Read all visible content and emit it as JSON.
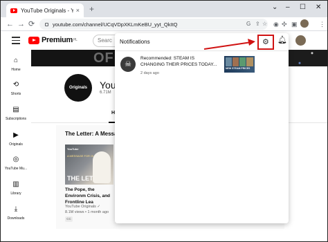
{
  "browser": {
    "tab_title": "YouTube Originals - YouTube",
    "tab_close": "×",
    "new_tab": "+",
    "url": "youtube.com/channel/UCqVDpXKLmKeBU_yyt_QkItQ",
    "window_controls": {
      "chevron": "⌄",
      "minimize": "–",
      "maximize": "☐",
      "close": "✕"
    },
    "nav": {
      "back": "←",
      "forward": "→",
      "reload": "⟳"
    }
  },
  "youtube": {
    "logo_text": "Premium",
    "logo_region": "PL",
    "search_placeholder": "Searc",
    "nav_items": [
      {
        "icon": "home-icon",
        "glyph": "⌂",
        "label": "Home"
      },
      {
        "icon": "shorts-icon",
        "glyph": "⟲",
        "label": "Shorts"
      },
      {
        "icon": "subscriptions-icon",
        "glyph": "▤",
        "label": "Subscriptions"
      },
      {
        "icon": "originals-icon",
        "glyph": "▶",
        "label": "Originals"
      },
      {
        "icon": "music-icon",
        "glyph": "◎",
        "label": "YouTube Mu..."
      },
      {
        "icon": "library-icon",
        "glyph": "▥",
        "label": "Library"
      },
      {
        "icon": "downloads-icon",
        "glyph": "⤓",
        "label": "Downloads"
      }
    ],
    "banner_text": "OF",
    "channel": {
      "avatar_text": "Originals",
      "name": "YouTu",
      "subscribers": "6.71M"
    },
    "tab_home": "H",
    "section_title": "The Letter: A Messag",
    "video": {
      "thumb_label": "YouTube",
      "thumb_sub": "A MESSAGE FOR OUR EARTH",
      "thumb_big": "THE LETTER",
      "title": "The Pope, the Environm Crisis, and Frontline Lea",
      "channel": "YouTube Originals ✓",
      "meta": "8.1M views • 1 month ago",
      "badge": "CC"
    }
  },
  "notifications": {
    "title": "Notifications",
    "items": [
      {
        "text": "Recommended: STEAM IS CHANGING THEIR PRICES TODAY...",
        "time": "2 days ago",
        "thumb_label": "NEW STEAM PRICES"
      }
    ]
  },
  "colors": {
    "annotation_red": "#d01212",
    "youtube_red": "#ff0000"
  }
}
